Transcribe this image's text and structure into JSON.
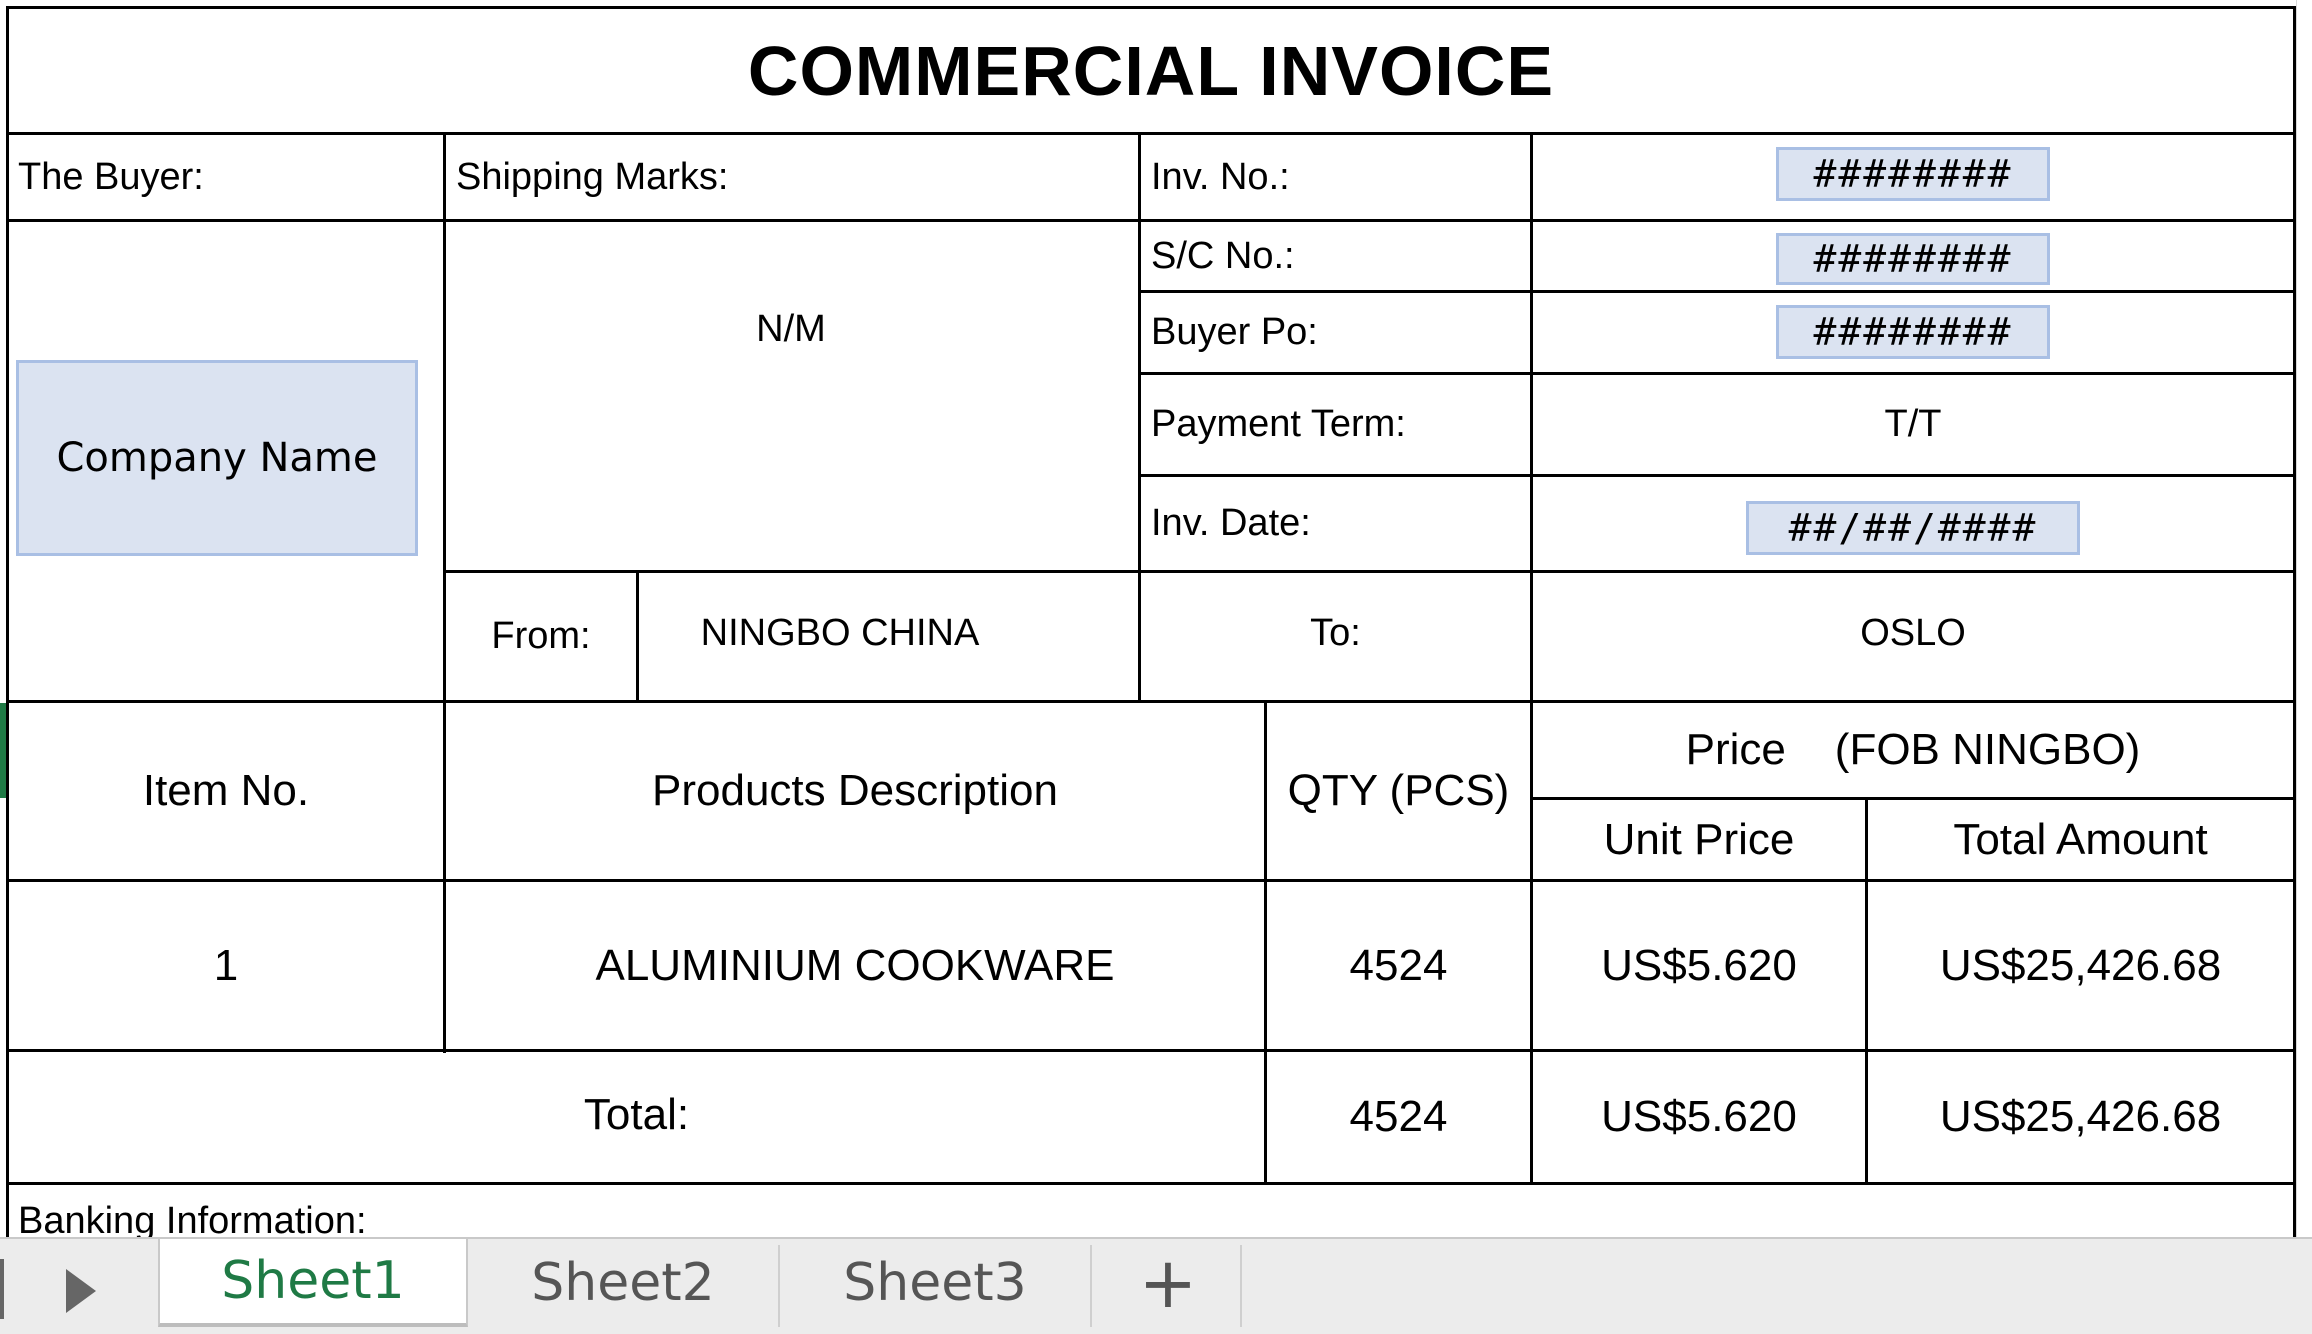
{
  "invoice": {
    "title": "COMMERCIAL  INVOICE",
    "buyer_label": "The Buyer:",
    "company_name": "Company Name",
    "shipping_marks_label": "Shipping Marks:",
    "shipping_marks_value": "N/M",
    "inv_no_label": "Inv. No.:",
    "inv_no_value": "########",
    "sc_no_label": "S/C No.:",
    "sc_no_value": "########",
    "buyer_po_label": "Buyer Po:",
    "buyer_po_value": "########",
    "payment_term_label": "Payment Term:",
    "payment_term_value": "T/T",
    "inv_date_label": "Inv. Date:",
    "inv_date_value": "##/##/####",
    "from_label": "From:",
    "from_value": "NINGBO CHINA",
    "to_label": "To:",
    "to_value": "OSLO",
    "banking_label": "Banking Information:"
  },
  "table": {
    "headers": {
      "item_no": "Item  No.",
      "description": "Products Description",
      "qty": "QTY (PCS)",
      "price_group": "Price    (FOB NINGBO)",
      "unit_price": "Unit Price",
      "total_amount": "Total Amount"
    },
    "rows": [
      {
        "item_no": "1",
        "description": "ALUMINIUM COOKWARE",
        "qty": "4524",
        "unit_price": "US$5.620",
        "total_amount": "US$25,426.68"
      }
    ],
    "total": {
      "label": "Total:",
      "qty": "4524",
      "unit_price": "US$5.620",
      "total_amount": "US$25,426.68"
    }
  },
  "sheet_tabs": {
    "tabs": [
      "Sheet1",
      "Sheet2",
      "Sheet3"
    ],
    "active": "Sheet1",
    "add_label": "+"
  },
  "colors": {
    "accent_green": "#1f7a45",
    "highlight_fill": "#dbe3f1",
    "highlight_border": "#a9bfe4"
  }
}
